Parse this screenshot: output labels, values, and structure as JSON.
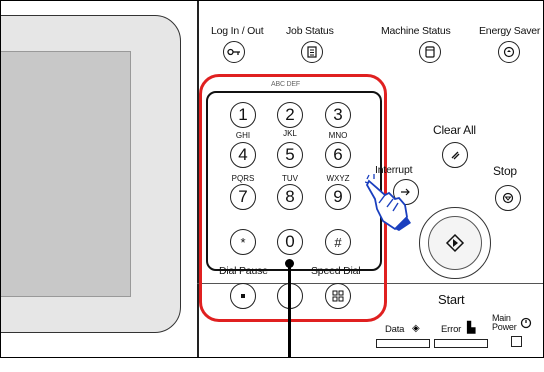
{
  "top_buttons": {
    "login_out": "Log In / Out",
    "job_status": "Job Status",
    "machine_status": "Machine Status",
    "energy_saver": "Energy Saver"
  },
  "keypad": {
    "top_partial": "ABC  DEF",
    "keys": [
      {
        "digit": "1",
        "letters": ""
      },
      {
        "digit": "2",
        "letters": ""
      },
      {
        "digit": "3",
        "letters": ""
      },
      {
        "digit": "4",
        "letters": "GHI"
      },
      {
        "digit": "5",
        "letters": "JKL"
      },
      {
        "digit": "6",
        "letters": "MNO"
      },
      {
        "digit": "7",
        "letters": "PQRS"
      },
      {
        "digit": "8",
        "letters": "TUV"
      },
      {
        "digit": "9",
        "letters": "WXYZ"
      },
      {
        "digit": "*",
        "letters": ""
      },
      {
        "digit": "0",
        "letters": ""
      },
      {
        "digit": "#",
        "letters": ""
      }
    ],
    "dial_pause": "Dial Pause",
    "speed_dial": "Speed Dial"
  },
  "right_controls": {
    "clear_all": "Clear All",
    "interrupt": "Interrupt",
    "stop": "Stop",
    "start": "Start",
    "data": "Data",
    "error": "Error",
    "main_power": "Main\nPower"
  },
  "colors": {
    "highlight": "#e02020",
    "hand_accent": "#1a3fbf"
  },
  "icons": {
    "login": "key-icon",
    "job_status": "document-list-icon",
    "machine_status": "machine-icon",
    "energy_saver": "energy-icon",
    "clear_all": "slash-icon",
    "interrupt": "interrupt-icon",
    "stop": "stop-icon",
    "start": "diamond-start-icon",
    "hand": "pointing-hand-icon"
  }
}
